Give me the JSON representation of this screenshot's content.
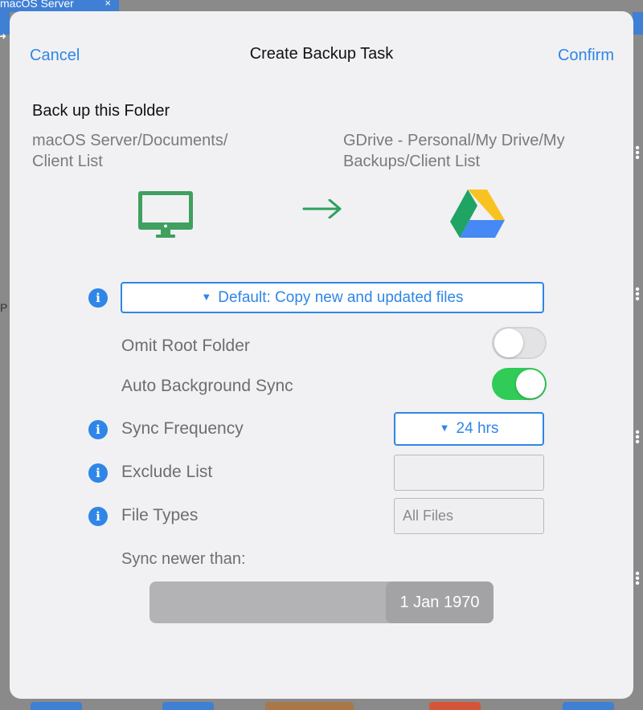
{
  "background": {
    "tab_label": "macOS Server",
    "tab_close": "×",
    "side_letter": "P"
  },
  "nav": {
    "cancel_label": "Cancel",
    "title": "Create Backup Task",
    "confirm_label": "Confirm"
  },
  "folder": {
    "heading": "Back up this Folder",
    "source_line1": "macOS Server/Documents/",
    "source_line2": "Client List",
    "dest_line1": "GDrive - Personal/My Drive/My",
    "dest_line2": "Backups/Client List"
  },
  "icons": {
    "source": "desktop-monitor-icon",
    "direction": "arrow-right-icon",
    "destination": "google-drive-icon",
    "info": "i"
  },
  "copy_mode": {
    "caret": "▼",
    "selected": "Default: Copy new and updated files"
  },
  "options": {
    "omit_root_label": "Omit Root Folder",
    "omit_root_on": false,
    "auto_sync_label": "Auto Background Sync",
    "auto_sync_on": true,
    "frequency_label": "Sync Frequency",
    "frequency_caret": "▼",
    "frequency_value": "24 hrs",
    "exclude_label": "Exclude List",
    "exclude_value": "",
    "file_types_label": "File Types",
    "file_types_placeholder": "All Files",
    "sync_newer_label": "Sync newer than:",
    "sync_newer_value": "1 Jan 1970"
  },
  "colors": {
    "accent": "#2f86e6",
    "toggle_on": "#30cc57",
    "monitor_green": "#3fa060"
  }
}
